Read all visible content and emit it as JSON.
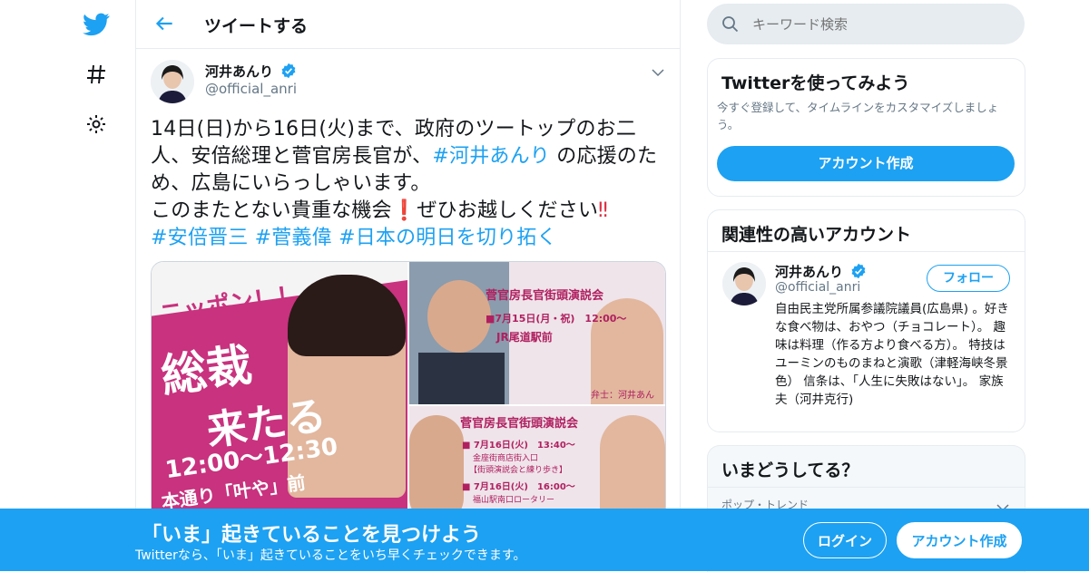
{
  "app": {
    "brand_color": "#1da1f2"
  },
  "nav": {
    "icons": [
      "twitter-bird-icon",
      "hashtag-icon",
      "gear-icon"
    ]
  },
  "header": {
    "title": "ツイートする"
  },
  "tweet": {
    "author_name": "河井あんり",
    "author_handle": "@official_anri",
    "text_plain_1": "14日(日)から16日(火)まで、政府のツートップのお二人、安倍総理と菅官房長官が、",
    "hashtag_1": "#河井あんり",
    "text_plain_2": " の応援のため、広島にいらっしゃいます。",
    "text_plain_3": "このまたとない貴重な機会",
    "exclaim_1": "❗",
    "text_plain_4": "ぜひお越しください",
    "exclaim_2": "‼",
    "hashtags": [
      "#安倍晋三",
      "#菅義偉",
      "#日本の明日を切り拓く"
    ],
    "media": {
      "left": {
        "line1": "ニッポン！！",
        "line2": "総裁",
        "line3": "来たる",
        "time": "12:00〜12:30",
        "place": "本通り「叶や」前"
      },
      "top_right": {
        "title": "菅官房長官街頭演説会",
        "date": "■7月15日(月・祝)　12:00〜",
        "place": "JR尾道駅前",
        "caption": "弁士：河井あん"
      },
      "bottom_right": {
        "title": "菅官房長官街頭演説会",
        "date1": "■ 7月16日(火)　13:40〜",
        "place1": "金座街商店街入口",
        "note1": "【街頭演説会と練り歩き】",
        "date2": "■ 7月16日(火)　16:00〜",
        "place2": "福山駅南口ロータリー"
      }
    }
  },
  "search": {
    "placeholder": "キーワード検索"
  },
  "signup_card": {
    "title": "Twitterを使ってみよう",
    "description": "今すぐ登録して、タイムラインをカスタマイズしましょう。",
    "button": "アカウント作成"
  },
  "related_card": {
    "title": "関連性の高いアカウント",
    "name": "河井あんり",
    "handle": "@official_anri",
    "follow_label": "フォロー",
    "bio": "自由民主党所属参議院議員(広島県) 。好きな食べ物は、おやつ（チョコレート）。 趣味は料理（作る方より食べる方）。 特技はユーミンのものまねと演歌（津軽海峡冬景色） 信条は、「人生に失敗はない」。 家族 夫（河井克行)"
  },
  "trends_card": {
    "title": "いまどうしてる？",
    "first_item": "ポップ・トレンド"
  },
  "banner": {
    "title": "「いま」起きていることを見つけよう",
    "subtitle": "Twitterなら、「いま」起きていることをいち早くチェックできます。",
    "login": "ログイン",
    "signup": "アカウント作成"
  }
}
